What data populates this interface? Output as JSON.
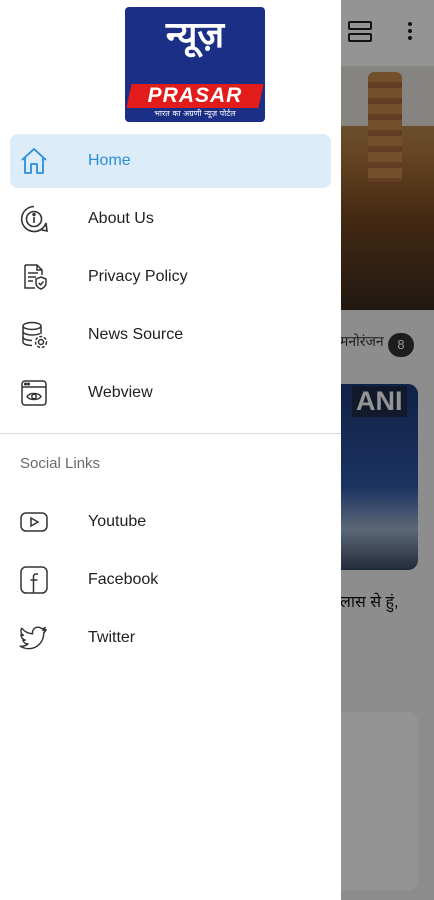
{
  "app": {
    "logo_text_hindi": "न्यूज़",
    "logo_text_english": "PRASAR",
    "logo_tagline": "भारत का अग्रणी न्यूज़ पोर्टल"
  },
  "drawer": {
    "menu": [
      {
        "label": "Home",
        "icon": "home-icon",
        "active": true
      },
      {
        "label": "About Us",
        "icon": "info-icon",
        "active": false
      },
      {
        "label": "Privacy Policy",
        "icon": "policy-document-icon",
        "active": false
      },
      {
        "label": "News Source",
        "icon": "database-settings-icon",
        "active": false
      },
      {
        "label": "Webview",
        "icon": "browser-eye-icon",
        "active": false
      }
    ],
    "social_title": "Social Links",
    "social": [
      {
        "label": "Youtube",
        "icon": "youtube-icon"
      },
      {
        "label": "Facebook",
        "icon": "facebook-icon"
      },
      {
        "label": "Twitter",
        "icon": "twitter-icon"
      }
    ]
  },
  "background": {
    "category_text": "मनोरंजन",
    "category_count": "8",
    "video_watermark": "ANI",
    "headline_fragment": "लास से हुं,"
  },
  "colors": {
    "accent": "#2a8dd8",
    "active_bg": "#dcecf9",
    "logo_blue": "#1c2f86",
    "logo_red": "#e21b1b"
  }
}
